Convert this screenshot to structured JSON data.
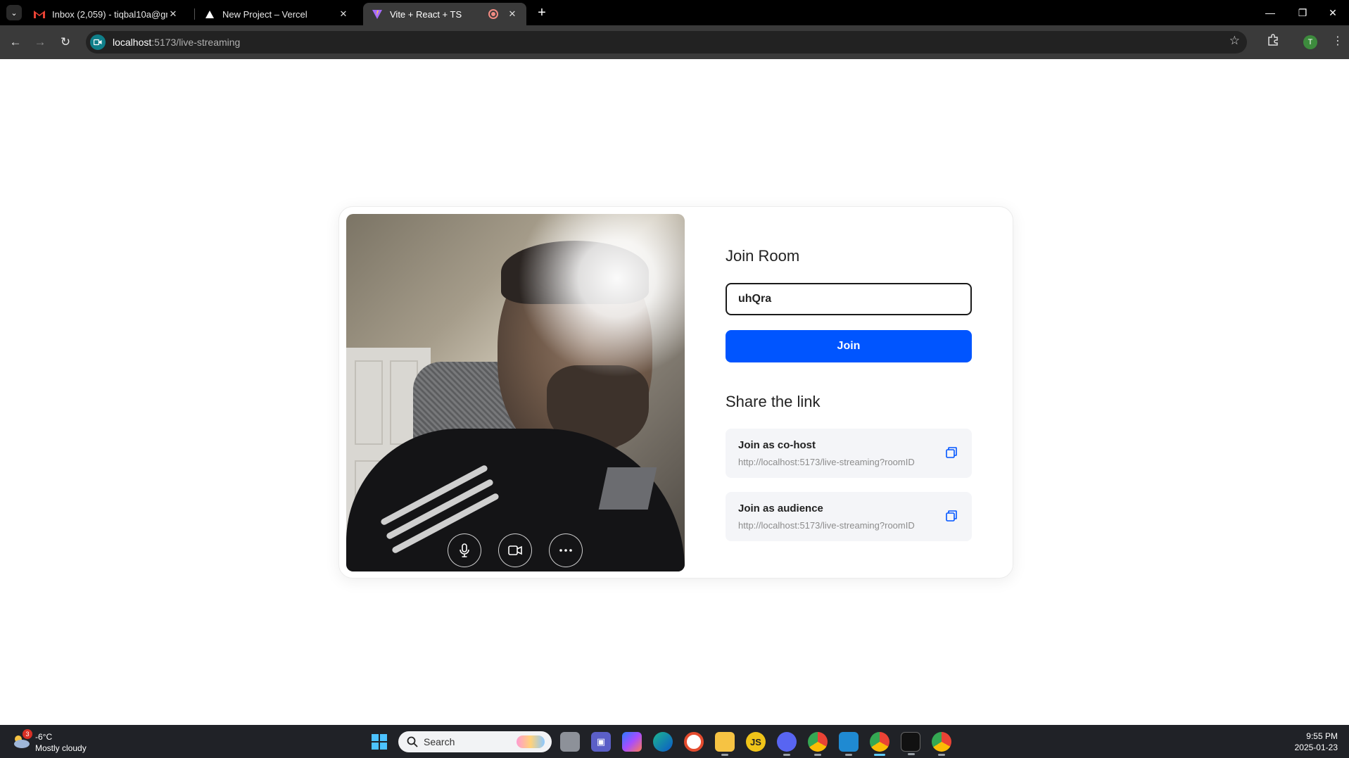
{
  "browser": {
    "tabs": [
      {
        "title": "Inbox (2,059) - tiqbal10a@gma",
        "icon": "gmail-icon"
      },
      {
        "title": "New Project – Vercel",
        "icon": "vercel-icon"
      },
      {
        "title": "Vite + React + TS",
        "icon": "vite-icon",
        "active": true
      }
    ],
    "url_host": "localhost",
    "url_path": ":5173/live-streaming",
    "profile_initial": "T"
  },
  "page": {
    "join_title": "Join Room",
    "room_input_value": "uhQra",
    "join_button": "Join",
    "share_title": "Share the link",
    "links": [
      {
        "label": "Join as co-host",
        "url": "http://localhost:5173/live-streaming?roomID"
      },
      {
        "label": "Join as audience",
        "url": "http://localhost:5173/live-streaming?roomID"
      }
    ],
    "accent_color": "#0055ff"
  },
  "taskbar": {
    "weather_badge": "3",
    "temperature": "-6°C",
    "weather_text": "Mostly cloudy",
    "search_placeholder": "Search",
    "js_label": "JS",
    "time": "9:55 PM",
    "date": "2025-01-23"
  }
}
